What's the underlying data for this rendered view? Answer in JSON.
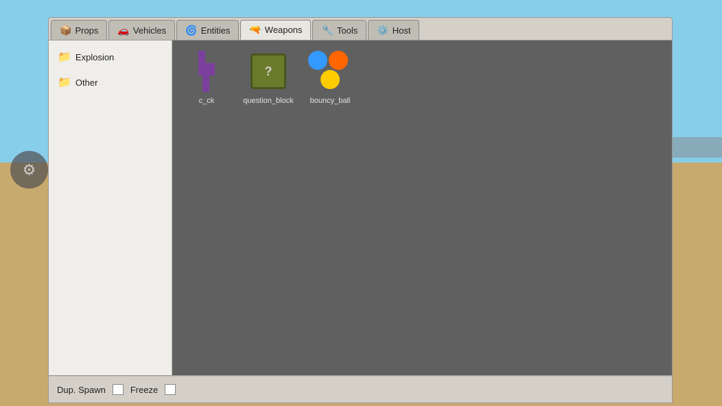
{
  "background": {
    "sky_color": "#87CEEB",
    "ground_color": "#C8A96E"
  },
  "tabs": [
    {
      "id": "props",
      "label": "Props",
      "icon": "📦",
      "active": false
    },
    {
      "id": "vehicles",
      "label": "Vehicles",
      "icon": "🚗",
      "active": false
    },
    {
      "id": "entities",
      "label": "Entities",
      "icon": "🌀",
      "active": false
    },
    {
      "id": "weapons",
      "label": "Weapons",
      "icon": "🔫",
      "active": true
    },
    {
      "id": "tools",
      "label": "Tools",
      "icon": "🔧",
      "active": false
    },
    {
      "id": "host",
      "label": "Host",
      "icon": "⚙️",
      "active": false
    }
  ],
  "sidebar": {
    "items": [
      {
        "id": "explosion",
        "label": "Explosion",
        "icon": "📁"
      },
      {
        "id": "other",
        "label": "Other",
        "icon": "📁"
      }
    ]
  },
  "items": [
    {
      "id": "c_ck",
      "label": "c_ck",
      "type": "character"
    },
    {
      "id": "question_block",
      "label": "question_block",
      "type": "block"
    },
    {
      "id": "bouncy_ball",
      "label": "bouncy_ball",
      "type": "ball"
    }
  ],
  "bottom_bar": {
    "dup_spawn_label": "Dup. Spawn",
    "freeze_label": "Freeze"
  }
}
